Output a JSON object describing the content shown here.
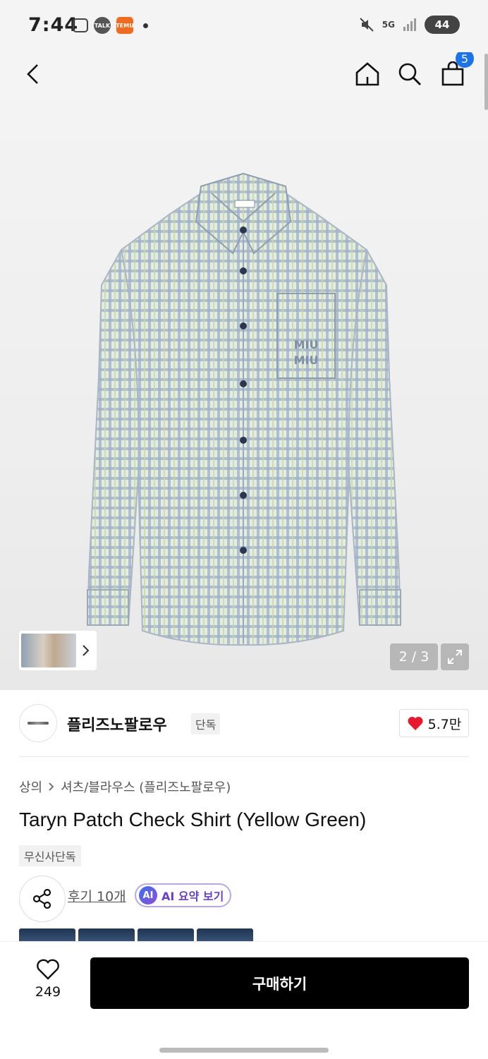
{
  "status_bar": {
    "time": "7:44",
    "left_icons": [
      "gallery-icon",
      "talk-icon",
      "temu-icon"
    ],
    "talk_label": "TALK",
    "temu_label": "TEMU",
    "network": "5G",
    "battery": "44"
  },
  "nav": {
    "cart_count": "5"
  },
  "gallery": {
    "counter": "2 / 3"
  },
  "brand": {
    "name": "플리즈노팔로우",
    "tag": "단독",
    "likes": "5.7만"
  },
  "breadcrumb": {
    "category": "상의",
    "subcategory": "셔츠/블라우스 (플리즈노팔로우)"
  },
  "product": {
    "title": "Taryn Patch Check Shirt (Yellow Green)",
    "badge": "무신사단독"
  },
  "actions": {
    "review_link": "후기 10개",
    "ai_badge": "AI",
    "ai_label": "AI 요약 보기"
  },
  "bottom_bar": {
    "wish_count": "249",
    "buy_label": "구매하기"
  },
  "colors": {
    "accent_blue": "#1a73e8",
    "heart_red": "#e8192c",
    "ai_purple": "#6a3fc7",
    "buy_black": "#000000"
  }
}
